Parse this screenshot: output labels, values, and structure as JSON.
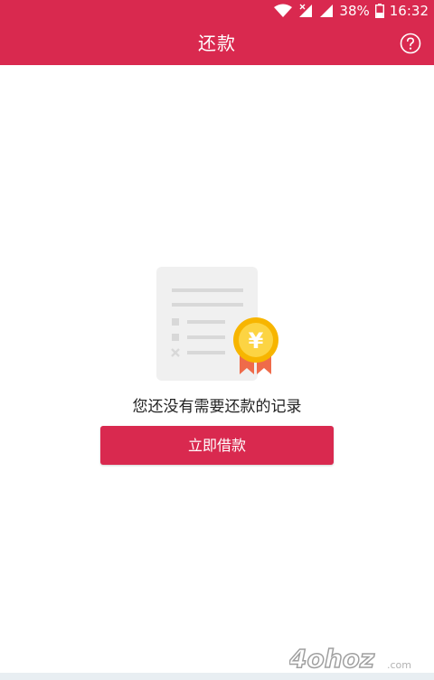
{
  "status_bar": {
    "battery": "38%",
    "time": "16:32"
  },
  "header": {
    "title": "还款",
    "help_icon": "help-circle-icon"
  },
  "empty_state": {
    "illustration_icon": "document-coin-badge-icon",
    "currency_symbol": "¥",
    "message": "您还没有需要还款的记录"
  },
  "actions": {
    "borrow_label": "立即借款"
  },
  "watermark": {
    "text": "4ohoz.com"
  },
  "colors": {
    "accent": "#d9294f",
    "coin": "#f7b500",
    "ribbon": "#ef6b4a",
    "document": "#f0f0f0"
  }
}
